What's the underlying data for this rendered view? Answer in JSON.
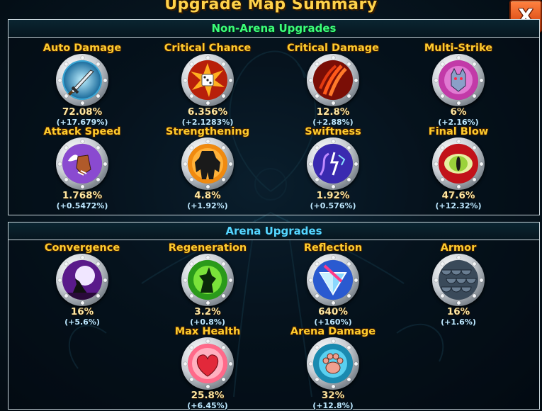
{
  "title": "Upgrade Map Summary",
  "close_label": "X",
  "sections": [
    {
      "header": "Non-Arena Upgrades",
      "items": [
        {
          "name": "Auto Damage",
          "value": "72.08%",
          "bonus": "(+17.679%)",
          "icon": "sword-icon"
        },
        {
          "name": "Critical Chance",
          "value": "6.356%",
          "bonus": "(+2.1283%)",
          "icon": "explosion-dice-icon"
        },
        {
          "name": "Critical Damage",
          "value": "12.8%",
          "bonus": "(+2.88%)",
          "icon": "claw-slash-icon"
        },
        {
          "name": "Multi-Strike",
          "value": "6%",
          "bonus": "(+2.16%)",
          "icon": "wolf-pack-icon"
        },
        {
          "name": "Attack Speed",
          "value": "1.768%",
          "bonus": "(+0.5472%)",
          "icon": "winged-paw-icon"
        },
        {
          "name": "Strengthening",
          "value": "4.8%",
          "bonus": "(+1.92%)",
          "icon": "beast-silhouette-icon"
        },
        {
          "name": "Swiftness",
          "value": "1.92%",
          "bonus": "(+0.576%)",
          "icon": "lightning-whip-icon"
        },
        {
          "name": "Final Blow",
          "value": "47.6%",
          "bonus": "(+12.32%)",
          "icon": "eye-icon"
        }
      ]
    },
    {
      "header": "Arena Upgrades",
      "items": [
        {
          "name": "Convergence",
          "value": "16%",
          "bonus": "(+5.6%)",
          "icon": "howling-wolf-moon-icon"
        },
        {
          "name": "Regeneration",
          "value": "3.2%",
          "bonus": "(+0.8%)",
          "icon": "regen-wolf-icon"
        },
        {
          "name": "Reflection",
          "value": "640%",
          "bonus": "(+160%)",
          "icon": "crystal-shield-icon"
        },
        {
          "name": "Armor",
          "value": "16%",
          "bonus": "(+1.6%)",
          "icon": "scale-armor-icon"
        },
        {
          "name": "Max Health",
          "value": "25.8%",
          "bonus": "(+6.45%)",
          "icon": "heart-icon"
        },
        {
          "name": "Arena Damage",
          "value": "32%",
          "bonus": "(+12.8%)",
          "icon": "paw-print-icon"
        }
      ]
    }
  ],
  "colors": {
    "title": "#ffd24a",
    "non_arena_header": "#3cff7a",
    "arena_header": "#56d6ff",
    "close_button": "#e2561d"
  }
}
